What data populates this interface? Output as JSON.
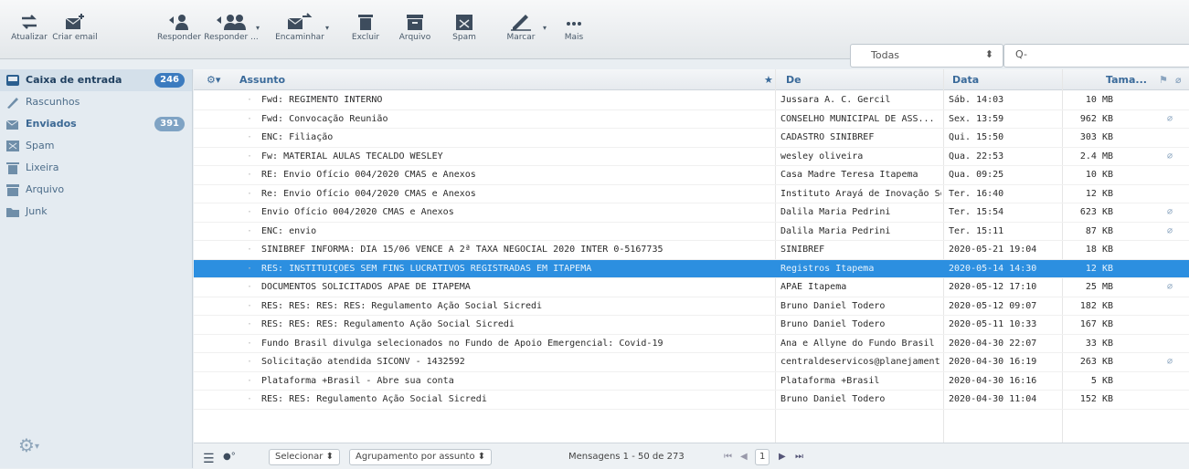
{
  "toolbar": {
    "buttons": [
      {
        "label": "Atualizar",
        "icon": "refresh-icon"
      },
      {
        "label": "Criar email",
        "icon": "compose-icon"
      },
      {
        "label": "Responder",
        "icon": "reply-icon"
      },
      {
        "label": "Responder ...",
        "icon": "reply-all-icon"
      },
      {
        "label": "Encaminhar",
        "icon": "forward-icon"
      },
      {
        "label": "Excluir",
        "icon": "trash-icon"
      },
      {
        "label": "Arquivo",
        "icon": "archive-icon"
      },
      {
        "label": "Spam",
        "icon": "spam-icon"
      },
      {
        "label": "Marcar",
        "icon": "mark-icon"
      },
      {
        "label": "Mais",
        "icon": "more-icon"
      }
    ],
    "filter_value": "Todas",
    "search_icon_text": "Q-"
  },
  "folders": [
    {
      "label": "Caixa de entrada",
      "badge": "246",
      "icon": "inbox-icon"
    },
    {
      "label": "Rascunhos",
      "badge": "",
      "icon": "pencil-icon"
    },
    {
      "label": "Enviados",
      "badge": "391",
      "icon": "sent-icon"
    },
    {
      "label": "Spam",
      "badge": "",
      "icon": "spam-icon"
    },
    {
      "label": "Lixeira",
      "badge": "",
      "icon": "trash-icon"
    },
    {
      "label": "Arquivo",
      "badge": "",
      "icon": "archive-icon"
    },
    {
      "label": "Junk",
      "badge": "",
      "icon": "folder-icon"
    }
  ],
  "list_header": {
    "subject": "Assunto",
    "from": "De",
    "date": "Data",
    "size": "Tama..."
  },
  "messages": [
    {
      "subject": "Fwd: REGIMENTO INTERNO",
      "from": "Jussara A. C. Gercil",
      "date": "Sáb. 14:03",
      "size": "10 MB",
      "clip": false
    },
    {
      "subject": "Fwd: Convocação Reunião",
      "from": "CONSELHO MUNICIPAL DE ASS...",
      "date": "Sex. 13:59",
      "size": "962 KB",
      "clip": true
    },
    {
      "subject": "ENC: Filiação",
      "from": "CADASTRO SINIBREF",
      "date": "Qui. 15:50",
      "size": "303 KB",
      "clip": false
    },
    {
      "subject": "Fw: MATERIAL AULAS TECALDO WESLEY",
      "from": "wesley oliveira",
      "date": "Qua. 22:53",
      "size": "2.4 MB",
      "clip": true
    },
    {
      "subject": "RE: Envio Ofício 004/2020 CMAS e Anexos",
      "from": "Casa Madre Teresa Itapema",
      "date": "Qua. 09:25",
      "size": "10 KB",
      "clip": false
    },
    {
      "subject": "Re: Envio Ofício 004/2020 CMAS e Anexos",
      "from": "Instituto Arayá de Inovação So",
      "date": "Ter. 16:40",
      "size": "12 KB",
      "clip": false
    },
    {
      "subject": "Envio Ofício 004/2020 CMAS e Anexos",
      "from": "Dalila Maria Pedrini",
      "date": "Ter. 15:54",
      "size": "623 KB",
      "clip": true
    },
    {
      "subject": "ENC: envio",
      "from": "Dalila Maria Pedrini",
      "date": "Ter. 15:11",
      "size": "87 KB",
      "clip": true
    },
    {
      "subject": "SINIBREF INFORMA: DIA 15/06 VENCE A 2ª TAXA NEGOCIAL 2020 INTER 0-5167735",
      "from": "SINIBREF",
      "date": "2020-05-21 19:04",
      "size": "18 KB",
      "clip": false
    },
    {
      "subject": "RES: INSTITUIÇÕES SEM FINS LUCRATIVOS REGISTRADAS EM ITAPEMA",
      "from": "Registros Itapema",
      "date": "2020-05-14 14:30",
      "size": "12 KB",
      "clip": false,
      "selected": true
    },
    {
      "subject": "DOCUMENTOS SOLICITADOS APAE DE ITAPEMA",
      "from": "APAE Itapema",
      "date": "2020-05-12 17:10",
      "size": "25 MB",
      "clip": true
    },
    {
      "subject": "RES: RES: RES: RES: Regulamento Ação Social Sicredi",
      "from": "Bruno Daniel Todero",
      "date": "2020-05-12 09:07",
      "size": "182 KB",
      "clip": false
    },
    {
      "subject": "RES: RES: RES: Regulamento Ação Social Sicredi",
      "from": "Bruno Daniel Todero",
      "date": "2020-05-11 10:33",
      "size": "167 KB",
      "clip": false
    },
    {
      "subject": "Fundo Brasil divulga selecionados no Fundo de Apoio Emergencial: Covid-19",
      "from": "Ana e Allyne do Fundo Brasil",
      "date": "2020-04-30 22:07",
      "size": "33 KB",
      "clip": false
    },
    {
      "subject": "Solicitação atendida SICONV - 1432592",
      "from": "centraldeservicos@planejament...",
      "date": "2020-04-30 16:19",
      "size": "263 KB",
      "clip": true
    },
    {
      "subject": "Plataforma +Brasil - Abre sua conta",
      "from": "Plataforma +Brasil",
      "date": "2020-04-30 16:16",
      "size": "5 KB",
      "clip": false
    },
    {
      "subject": "RES: RES: Regulamento Ação Social Sicredi",
      "from": "Bruno Daniel Todero",
      "date": "2020-04-30 11:04",
      "size": "152 KB",
      "clip": false
    }
  ],
  "footer": {
    "select_label": "Selecionar",
    "group_label": "Agrupamento por assunto",
    "count_text": "Mensagens 1 - 50 de 273",
    "page_current": "1"
  },
  "colors": {
    "selection": "#2c8fe0",
    "accent": "#3b7bbf",
    "sidebar_bg": "#e4ebf1"
  }
}
